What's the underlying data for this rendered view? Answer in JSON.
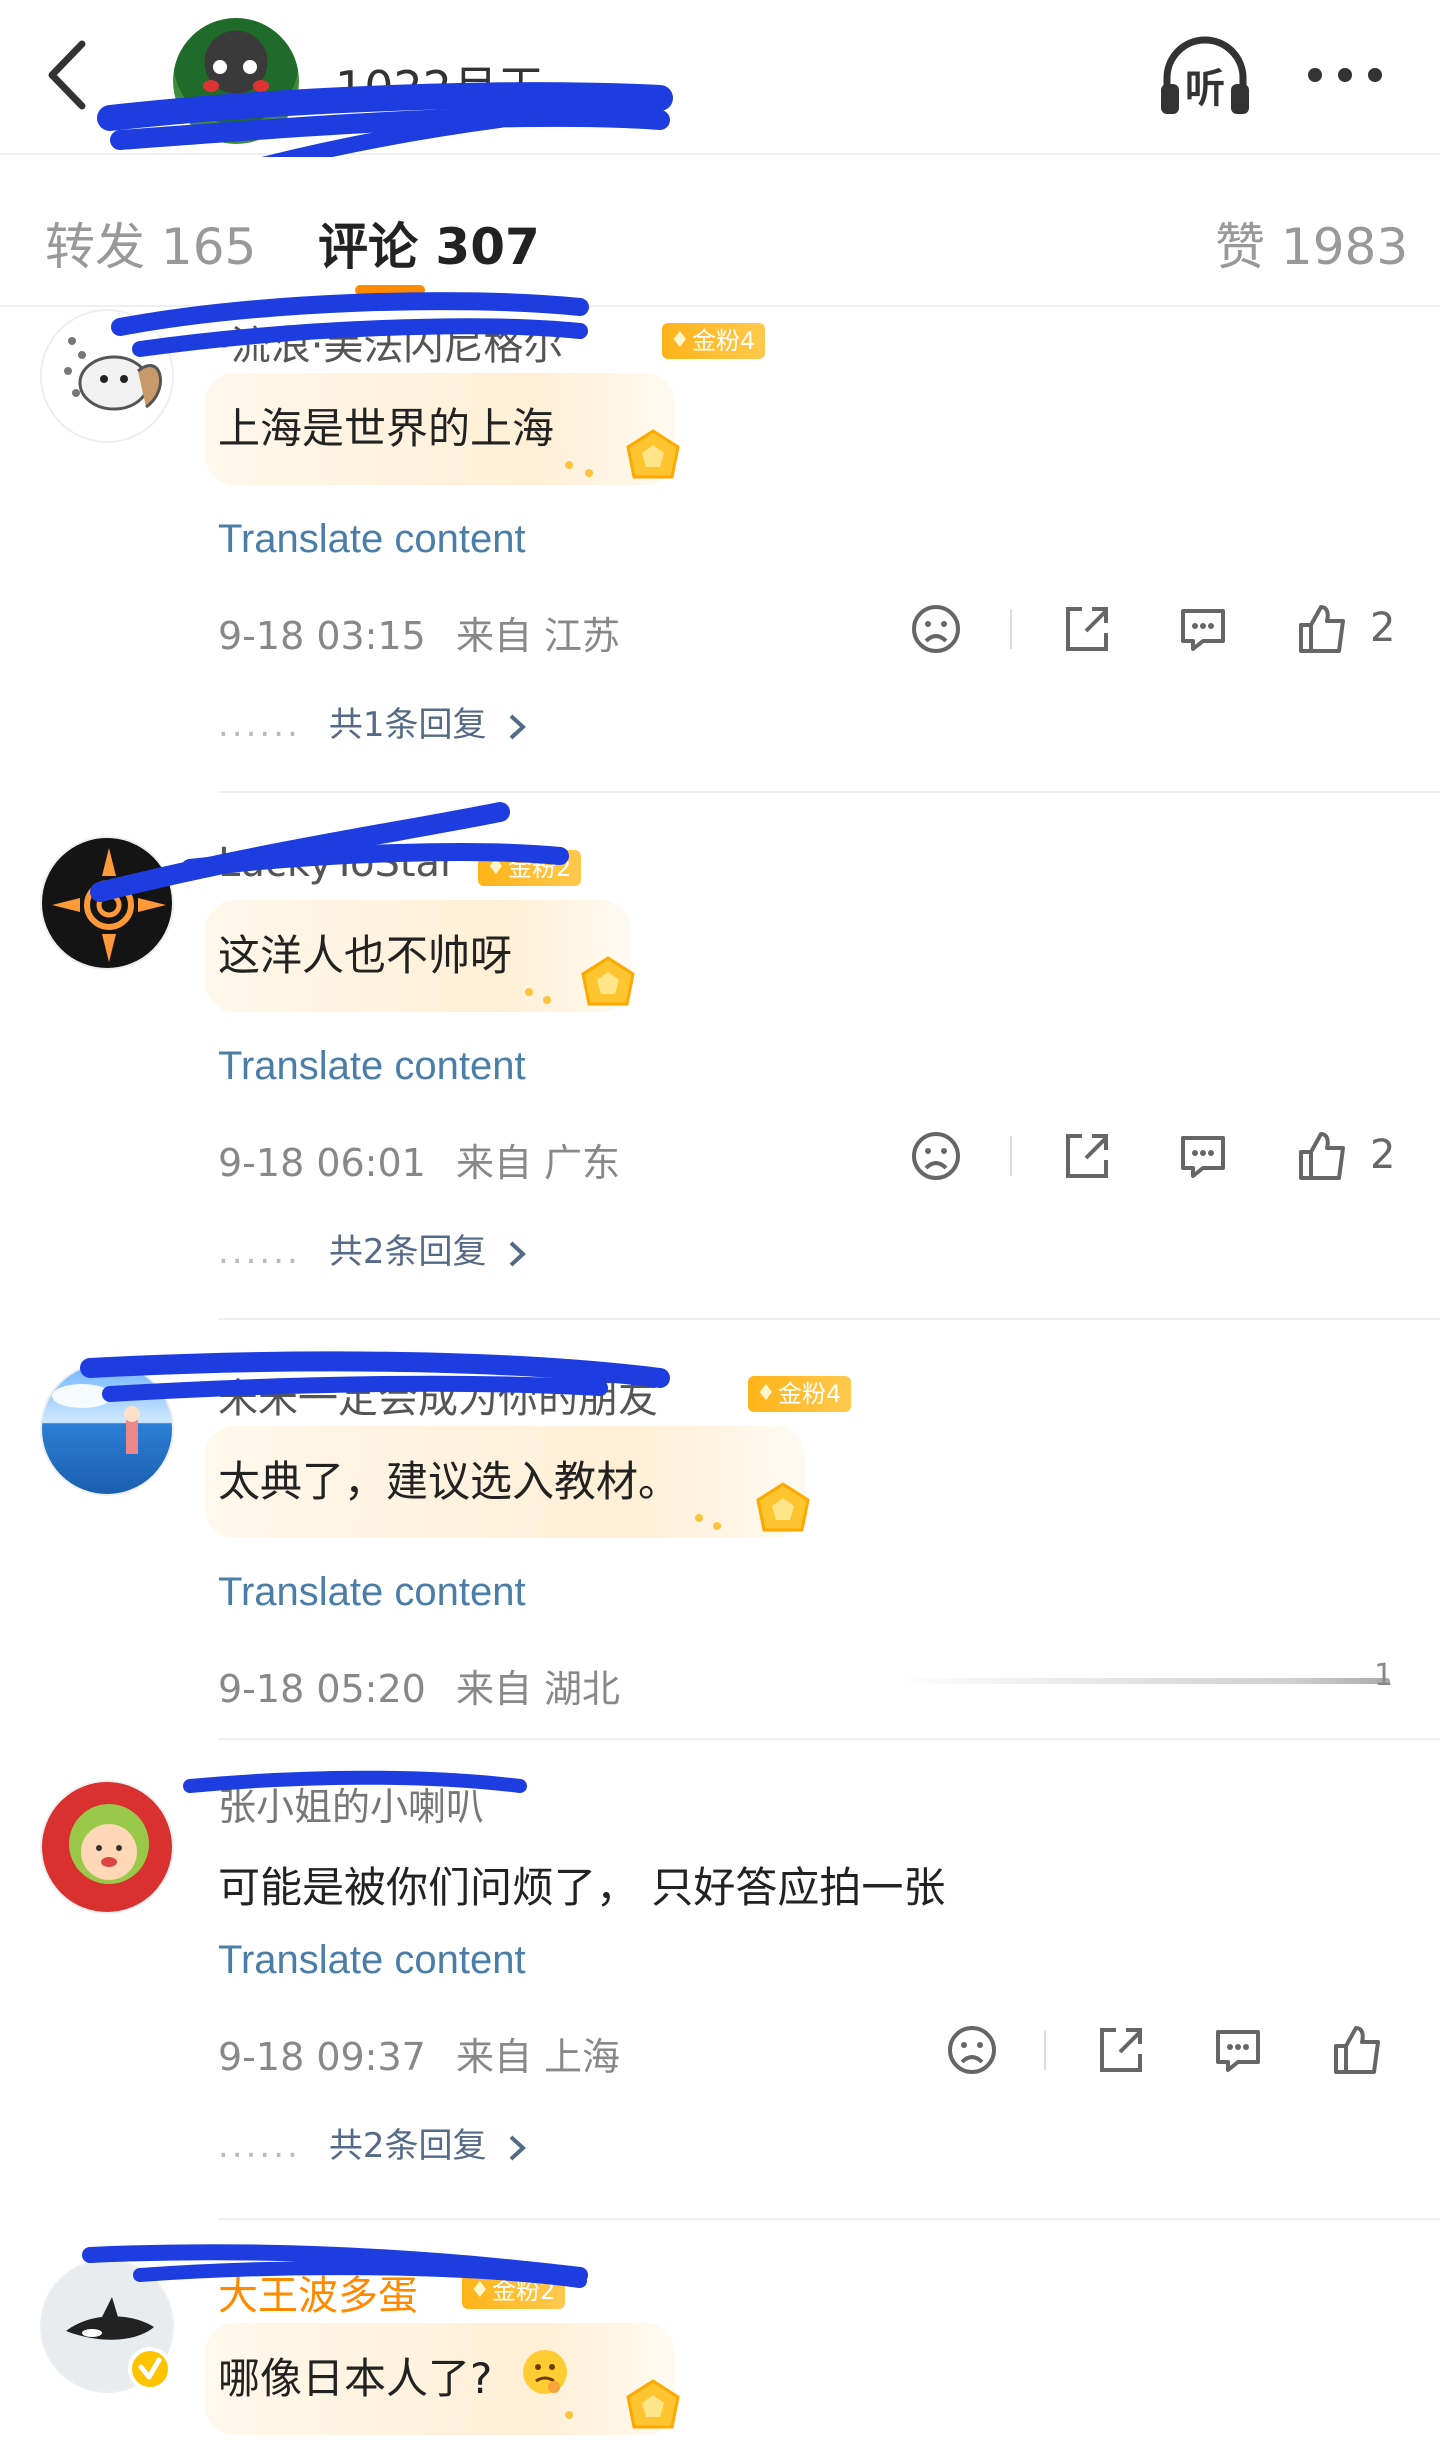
{
  "header": {
    "back_icon": "chevron-left-icon",
    "username": "1022月天",
    "listen_label": "听",
    "more_icon": "more-dots-icon"
  },
  "tabs": [
    {
      "label": "转发 165",
      "active": false
    },
    {
      "label": "评论 307",
      "active": true
    },
    {
      "label": "赞 1983",
      "active": false
    }
  ],
  "accent_color": "#ff8a00",
  "link_color": "#4a7ea8",
  "comments": [
    {
      "username": "·流浪·美法闪尼格尔",
      "badge": "金粉4",
      "text": "上海是世界的上海",
      "translate": "Translate content",
      "time": "9-18 03:15",
      "location": "来自 江苏",
      "likes": "2",
      "replies": "共1条回复"
    },
    {
      "username": "LuckyToStar",
      "badge": "金粉2",
      "text": "这洋人也不帅呀",
      "translate": "Translate content",
      "time": "9-18 06:01",
      "location": "来自 广东",
      "likes": "2",
      "replies": "共2条回复"
    },
    {
      "username": "米米一定会成为你的朋友",
      "badge": "金粉4",
      "text": "太典了，建议选入教材。",
      "translate": "Translate content",
      "time": "9-18 05:20",
      "location": "来自 湖北",
      "likes": "1",
      "replies": ""
    },
    {
      "username": "张小姐的小喇叭",
      "badge": "",
      "text": "可能是被你们问烦了， 只好答应拍一张",
      "translate": "Translate content",
      "time": "9-18 09:37",
      "location": "来自 上海",
      "likes": "",
      "replies": "共2条回复"
    },
    {
      "username": "大王波多蛋",
      "badge": "金粉2",
      "text": "哪像日本人了?",
      "translate": "",
      "time": "",
      "location": "",
      "likes": "",
      "replies": ""
    }
  ],
  "icons": {
    "dislike": "sad-face-icon",
    "share": "share-icon",
    "comment": "comment-bubble-icon",
    "like": "thumbs-up-icon",
    "reply_arrow": "chevron-right-icon",
    "crown": "crown-icon",
    "emoji": "thinking-face-emoji-icon"
  }
}
